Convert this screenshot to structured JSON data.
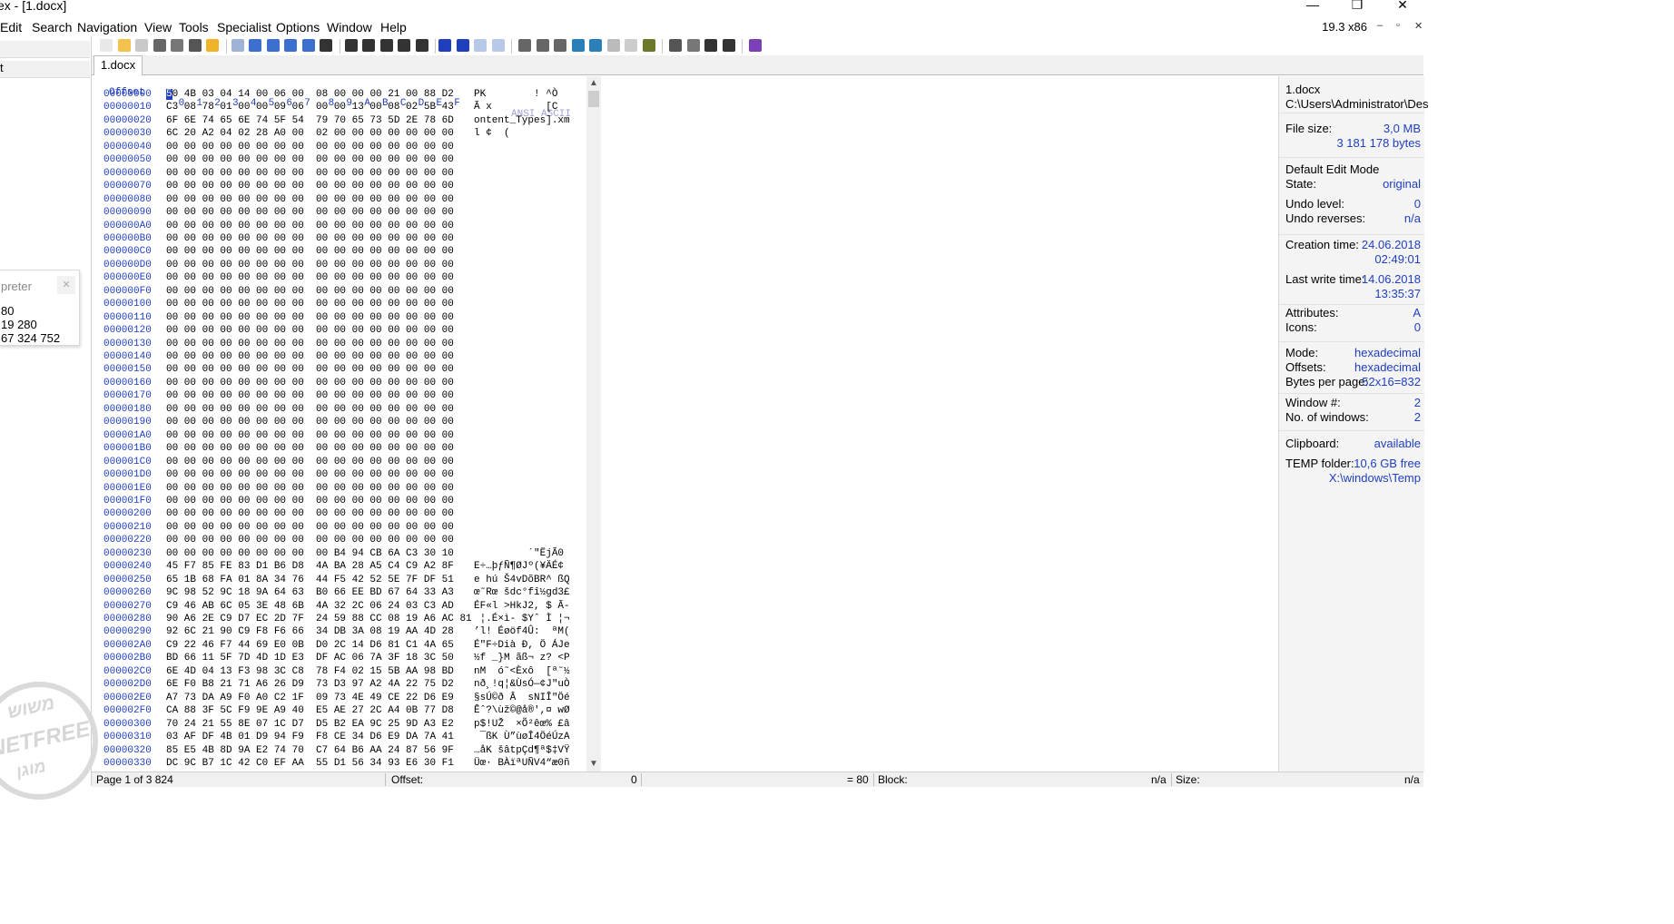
{
  "window": {
    "title": "ex - [1.docx]",
    "version": "19.3 x86",
    "minimize": "—",
    "restore": "❐",
    "close": "✕",
    "mdi_minimize": "–",
    "mdi_restore": "▫",
    "mdi_close": "✕"
  },
  "menu": [
    "Edit",
    "Search",
    "Navigation",
    "View",
    "Tools",
    "Specialist",
    "Options",
    "Window",
    "Help"
  ],
  "toolbar_icons": [
    {
      "name": "new-file-icon",
      "color": "#e8e8e8"
    },
    {
      "name": "open-file-icon",
      "color": "#f2c14e"
    },
    {
      "name": "save-icon",
      "color": "#c9c9c9"
    },
    {
      "name": "print-icon",
      "color": "#666666"
    },
    {
      "name": "print-preview-icon",
      "color": "#777777"
    },
    {
      "name": "properties-icon",
      "color": "#555555"
    },
    {
      "name": "export-icon",
      "color": "#f0b429"
    },
    {
      "name": "undo-icon",
      "color": "#9fb3d6"
    },
    {
      "name": "copy-icon",
      "color": "#3d6fd1"
    },
    {
      "name": "paste-icon",
      "color": "#3d6fd1"
    },
    {
      "name": "cut-icon",
      "color": "#3d6fd1"
    },
    {
      "name": "clipboard-icon",
      "color": "#3d6fd1"
    },
    {
      "name": "binary-icon",
      "color": "#333333"
    },
    {
      "name": "find-icon",
      "color": "#333333"
    },
    {
      "name": "find-next-icon",
      "color": "#333333"
    },
    {
      "name": "find-hex-icon",
      "color": "#333333"
    },
    {
      "name": "replace-icon",
      "color": "#333333"
    },
    {
      "name": "replace-hex-icon",
      "color": "#333333"
    },
    {
      "name": "goto-offset-icon",
      "color": "#1f3fbf"
    },
    {
      "name": "goto-sector-icon",
      "color": "#1f3fbf"
    },
    {
      "name": "back-icon",
      "color": "#b8c8e8"
    },
    {
      "name": "forward-icon",
      "color": "#b8c8e8"
    },
    {
      "name": "disk-icon",
      "color": "#666666"
    },
    {
      "name": "ram-icon",
      "color": "#666666"
    },
    {
      "name": "disk-edit-icon",
      "color": "#666666"
    },
    {
      "name": "calculator-icon",
      "color": "#2a7fb8"
    },
    {
      "name": "zoom-icon",
      "color": "#2a7fb8"
    },
    {
      "name": "analyze-icon",
      "color": "#bbbbbb"
    },
    {
      "name": "cloud-icon",
      "color": "#cccccc"
    },
    {
      "name": "gear-icon",
      "color": "#6a7a2a"
    },
    {
      "name": "sync-scroll-icon",
      "color": "#555555"
    },
    {
      "name": "compare-icon",
      "color": "#777777"
    },
    {
      "name": "previous-icon",
      "color": "#333333"
    },
    {
      "name": "next-icon",
      "color": "#333333"
    },
    {
      "name": "help-book-icon",
      "color": "#7b3fb8"
    }
  ],
  "left_panel": {
    "row1": "",
    "row2": "t",
    "interpreter": {
      "title": "preter",
      "close": "✕",
      "values": [
        "80",
        "19 280",
        "67 324 752"
      ]
    },
    "watermark": {
      "top": "משוש",
      "middle": "NETFREE",
      "bottom": "מוגן"
    }
  },
  "tab": {
    "label": "1.docx"
  },
  "hex": {
    "header_offset": "Offset",
    "header_bytes": " 0  1  2  3  4  5  6  7   8  9  A  B  C  D  E  F",
    "header_text": "ANSI ASCII",
    "first_byte_hi": "5",
    "first_row_rest": "0 4B 03 04 14 00 06 00  08 00 00 00 21 00 88 D2",
    "rows": [
      {
        "o": "00000000",
        "b": "",
        "t": "PK        ! ^Ò"
      },
      {
        "o": "00000010",
        "b": "C3 08 78 01 00 00 09 06  00 00 13 00 08 02 5B 43",
        "t": "Ã x         [C"
      },
      {
        "o": "00000020",
        "b": "6F 6E 74 65 6E 74 5F 54  79 70 65 73 5D 2E 78 6D",
        "t": "ontent_Types].xm"
      },
      {
        "o": "00000030",
        "b": "6C 20 A2 04 02 28 A0 00  02 00 00 00 00 00 00 00",
        "t": "l ¢  ("
      },
      {
        "o": "00000040",
        "b": "00 00 00 00 00 00 00 00  00 00 00 00 00 00 00 00",
        "t": ""
      },
      {
        "o": "00000050",
        "b": "00 00 00 00 00 00 00 00  00 00 00 00 00 00 00 00",
        "t": ""
      },
      {
        "o": "00000060",
        "b": "00 00 00 00 00 00 00 00  00 00 00 00 00 00 00 00",
        "t": ""
      },
      {
        "o": "00000070",
        "b": "00 00 00 00 00 00 00 00  00 00 00 00 00 00 00 00",
        "t": ""
      },
      {
        "o": "00000080",
        "b": "00 00 00 00 00 00 00 00  00 00 00 00 00 00 00 00",
        "t": ""
      },
      {
        "o": "00000090",
        "b": "00 00 00 00 00 00 00 00  00 00 00 00 00 00 00 00",
        "t": ""
      },
      {
        "o": "000000A0",
        "b": "00 00 00 00 00 00 00 00  00 00 00 00 00 00 00 00",
        "t": ""
      },
      {
        "o": "000000B0",
        "b": "00 00 00 00 00 00 00 00  00 00 00 00 00 00 00 00",
        "t": ""
      },
      {
        "o": "000000C0",
        "b": "00 00 00 00 00 00 00 00  00 00 00 00 00 00 00 00",
        "t": ""
      },
      {
        "o": "000000D0",
        "b": "00 00 00 00 00 00 00 00  00 00 00 00 00 00 00 00",
        "t": ""
      },
      {
        "o": "000000E0",
        "b": "00 00 00 00 00 00 00 00  00 00 00 00 00 00 00 00",
        "t": ""
      },
      {
        "o": "000000F0",
        "b": "00 00 00 00 00 00 00 00  00 00 00 00 00 00 00 00",
        "t": ""
      },
      {
        "o": "00000100",
        "b": "00 00 00 00 00 00 00 00  00 00 00 00 00 00 00 00",
        "t": ""
      },
      {
        "o": "00000110",
        "b": "00 00 00 00 00 00 00 00  00 00 00 00 00 00 00 00",
        "t": ""
      },
      {
        "o": "00000120",
        "b": "00 00 00 00 00 00 00 00  00 00 00 00 00 00 00 00",
        "t": ""
      },
      {
        "o": "00000130",
        "b": "00 00 00 00 00 00 00 00  00 00 00 00 00 00 00 00",
        "t": ""
      },
      {
        "o": "00000140",
        "b": "00 00 00 00 00 00 00 00  00 00 00 00 00 00 00 00",
        "t": ""
      },
      {
        "o": "00000150",
        "b": "00 00 00 00 00 00 00 00  00 00 00 00 00 00 00 00",
        "t": ""
      },
      {
        "o": "00000160",
        "b": "00 00 00 00 00 00 00 00  00 00 00 00 00 00 00 00",
        "t": ""
      },
      {
        "o": "00000170",
        "b": "00 00 00 00 00 00 00 00  00 00 00 00 00 00 00 00",
        "t": ""
      },
      {
        "o": "00000180",
        "b": "00 00 00 00 00 00 00 00  00 00 00 00 00 00 00 00",
        "t": ""
      },
      {
        "o": "00000190",
        "b": "00 00 00 00 00 00 00 00  00 00 00 00 00 00 00 00",
        "t": ""
      },
      {
        "o": "000001A0",
        "b": "00 00 00 00 00 00 00 00  00 00 00 00 00 00 00 00",
        "t": ""
      },
      {
        "o": "000001B0",
        "b": "00 00 00 00 00 00 00 00  00 00 00 00 00 00 00 00",
        "t": ""
      },
      {
        "o": "000001C0",
        "b": "00 00 00 00 00 00 00 00  00 00 00 00 00 00 00 00",
        "t": ""
      },
      {
        "o": "000001D0",
        "b": "00 00 00 00 00 00 00 00  00 00 00 00 00 00 00 00",
        "t": ""
      },
      {
        "o": "000001E0",
        "b": "00 00 00 00 00 00 00 00  00 00 00 00 00 00 00 00",
        "t": ""
      },
      {
        "o": "000001F0",
        "b": "00 00 00 00 00 00 00 00  00 00 00 00 00 00 00 00",
        "t": ""
      },
      {
        "o": "00000200",
        "b": "00 00 00 00 00 00 00 00  00 00 00 00 00 00 00 00",
        "t": ""
      },
      {
        "o": "00000210",
        "b": "00 00 00 00 00 00 00 00  00 00 00 00 00 00 00 00",
        "t": ""
      },
      {
        "o": "00000220",
        "b": "00 00 00 00 00 00 00 00  00 00 00 00 00 00 00 00",
        "t": ""
      },
      {
        "o": "00000230",
        "b": "00 00 00 00 00 00 00 00  00 B4 94 CB 6A C3 30 10",
        "t": "         ´\"ËjÃ0"
      },
      {
        "o": "00000240",
        "b": "45 F7 85 FE 83 D1 B6 D8  4A BA 28 A5 C4 C9 A2 8F",
        "t": "E÷…þƒÑ¶ØJº(¥ÄÉ¢"
      },
      {
        "o": "00000250",
        "b": "65 1B 68 FA 01 8A 34 76  44 F5 42 52 5E 7F DF 51",
        "t": "e hú Š4vDõBR^ ßQ"
      },
      {
        "o": "00000260",
        "b": "9C 98 52 9C 18 9A 64 63  B0 66 EE BD 67 64 33 A3",
        "t": "œ˜Rœ šdc°fî½gd3£"
      },
      {
        "o": "00000270",
        "b": "C9 46 AB 6C 05 3E 48 6B  4A 32 2C 06 24 03 C3 AD",
        "t": "ÉF«l >HkJ2, $ Ã-"
      },
      {
        "o": "00000280",
        "b": "90 A6 2E C9 D7 EC 2D 7F  24 59 88 CC 08 19 A6 AC 81",
        "t": " ¦.É×ì- $Yˆ Ì ¦¬"
      },
      {
        "o": "00000290",
        "b": "92 6C 21 90 C9 F8 F6 66  34 DB 3A 08 19 AA 4D 28",
        "t": "’l! Éøöf4Û:  ªM("
      },
      {
        "o": "000002A0",
        "b": "C9 22 46 F7 44 69 E0 0B  D0 2C 14 D6 81 C1 4A 65",
        "t": "É\"F÷Dià Ð, Ö ÁJe"
      },
      {
        "o": "000002B0",
        "b": "BD 66 11 5F 7D 4D 1D E3  DF AC 06 7A 3F 18 3C 50",
        "t": "½f _}M ãß¬ z? <P"
      },
      {
        "o": "000002C0",
        "b": "6E 4D 04 13 F3 98 3C C8  78 F4 02 15 5B AA 98 BD",
        "t": "nM  ó˜<Èxô  [ª˜½"
      },
      {
        "o": "000002D0",
        "b": "6E F0 B8 21 71 A6 26 D9  73 D3 97 A2 4A 22 75 D2",
        "t": "nð¸!q¦&ÙsÓ—¢J\"uÒ"
      },
      {
        "o": "000002E0",
        "b": "A7 73 DA A9 F0 A0 C2 1F  09 73 4E 49 CE 22 D6 E9",
        "t": "§sÚ©ð Â  sNIÎ\"Öé"
      },
      {
        "o": "000002F0",
        "b": "CA 88 3F 5C F9 9E A9 40  E5 AE 27 2C A4 0B 77 D8",
        "t": "Êˆ?\\ùž©@å®',¤ wØ"
      },
      {
        "o": "00000300",
        "b": "70 24 21 55 8E 07 1C D7  D5 B2 EA 9C 25 9D A3 E2",
        "t": "p$!UŽ  ×Õ²êœ% £â"
      },
      {
        "o": "00000310",
        "b": "03 AF DF 4B 01 D9 94 F9  F8 CE 34 D6 E9 DA 7A 41",
        "t": " ¯ßK Ù”ùøÎ4ÖéÚzA"
      },
      {
        "o": "00000320",
        "b": "85 E5 4B 8D 9A E2 74 70  C7 64 B6 AA 24 87 56 9F",
        "t": "…åK šâtpÇd¶ª$‡VŸ"
      },
      {
        "o": "00000330",
        "b": "DC 9C B7 1C 42 C0 EF AA  55 D1 56 34 93 E6 30 F1",
        "t": "Üœ· BÀïªUÑV4“æ0ñ"
      }
    ]
  },
  "info": {
    "file_name": "1.docx",
    "path": "C:\\Users\\Administrator\\Des",
    "file_size_label": "File size:",
    "file_size_value": "3,0 MB",
    "file_size_bytes": "3 181 178 bytes",
    "edit_mode": "Default Edit Mode",
    "state_label": "State:",
    "state_value": "original",
    "undo_level_label": "Undo level:",
    "undo_level_value": "0",
    "undo_reverses_label": "Undo reverses:",
    "undo_reverses_value": "n/a",
    "creation_label": "Creation time:",
    "creation_date": "24.06.2018",
    "creation_time": "02:49:01",
    "lastwrite_label": "Last write time:",
    "lastwrite_date": "14.06.2018",
    "lastwrite_time": "13:35:37",
    "attributes_label": "Attributes:",
    "attributes_value": "A",
    "icons_label": "Icons:",
    "icons_value": "0",
    "mode_label": "Mode:",
    "mode_value": "hexadecimal",
    "offsets_label": "Offsets:",
    "offsets_value": "hexadecimal",
    "bpp_label": "Bytes per page:",
    "bpp_value": "52x16=832",
    "window_label": "Window #:",
    "window_value": "2",
    "nwin_label": "No. of windows:",
    "nwin_value": "2",
    "clipboard_label": "Clipboard:",
    "clipboard_value": "available",
    "temp_label": "TEMP folder:",
    "temp_free": "10,6 GB free",
    "temp_path": "X:\\windows\\Temp"
  },
  "status": {
    "page": "Page 1 of 3 824",
    "offset_label": "Offset:",
    "offset_value": "0",
    "value": "= 80",
    "block_label": "Block:",
    "block_value": "n/a",
    "size_label": "Size:",
    "size_value": "n/a"
  }
}
